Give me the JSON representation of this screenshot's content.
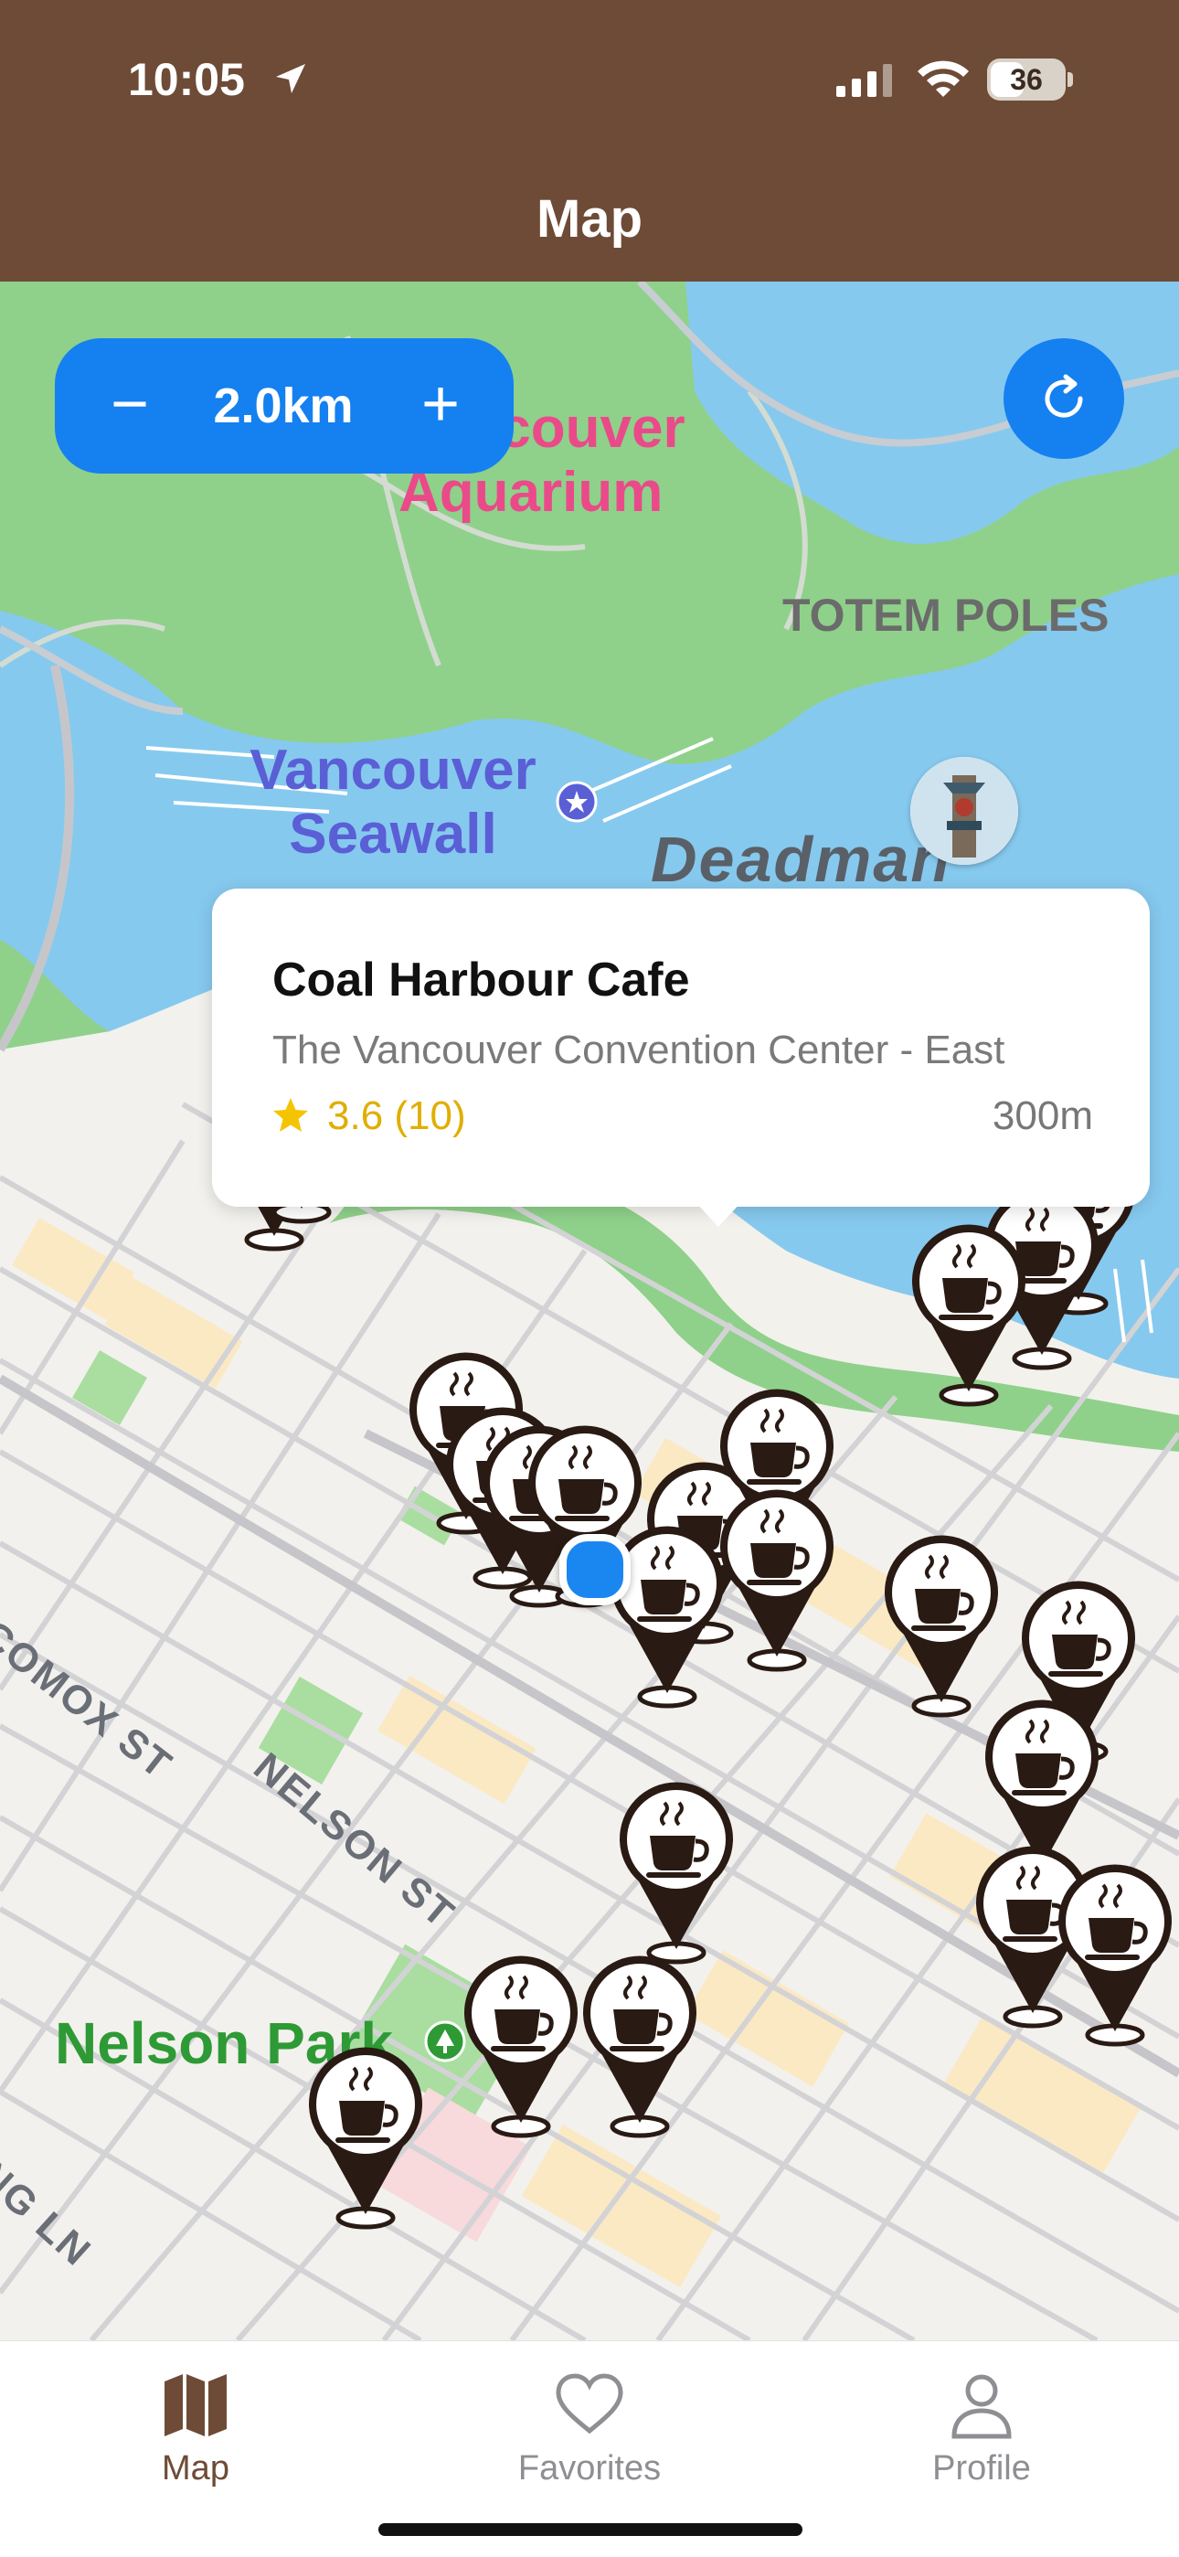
{
  "status_bar": {
    "time": "10:05",
    "battery": "36"
  },
  "nav": {
    "title": "Map"
  },
  "map": {
    "zoom": {
      "minus": "−",
      "value": "2.0km",
      "plus": "+"
    },
    "labels": {
      "aquarium": "Vancouver\nAquarium",
      "totem_poles": "TOTEM POLES",
      "seawall": "Vancouver\nSeawall",
      "deadman": "Deadman",
      "comox_st": "COMOX ST",
      "nelson_st": "NELSON ST",
      "nelson_park": "Nelson Park",
      "ng_ln": "NG LN"
    }
  },
  "callout": {
    "name": "Coal Harbour Cafe",
    "address": "The Vancouver Convention Center - East",
    "rating": "3.6 (10)",
    "distance": "300m"
  },
  "tabs": [
    {
      "label": "Map",
      "icon": "map-icon",
      "active": true
    },
    {
      "label": "Favorites",
      "icon": "heart-icon",
      "active": false
    },
    {
      "label": "Profile",
      "icon": "person-icon",
      "active": false
    }
  ],
  "colors": {
    "header": "#6e4b36",
    "accent": "#1580f0",
    "pin": "#2a1a14",
    "rating": "#e0ae00"
  }
}
